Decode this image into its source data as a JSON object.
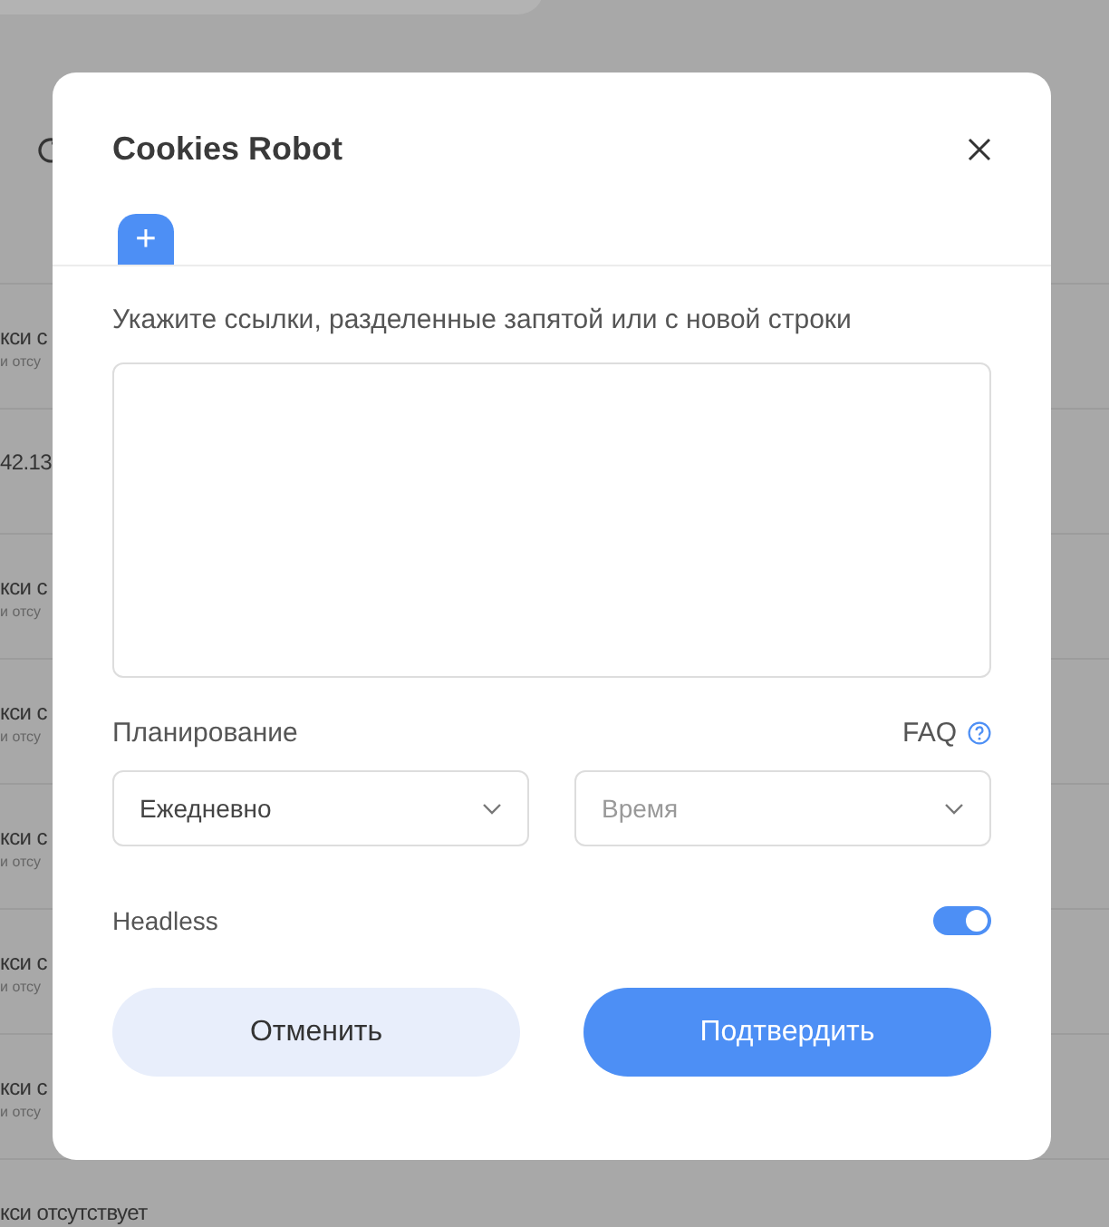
{
  "background": {
    "rows": [
      {
        "title": "кси с",
        "subtitle": "и отсу"
      },
      {
        "title": "42.13"
      },
      {
        "title": "кси с",
        "subtitle": "и отсу"
      },
      {
        "title": "кси с",
        "subtitle": "и отсу"
      },
      {
        "title": "кси с",
        "subtitle": "и отсу"
      },
      {
        "title": "кси с",
        "subtitle": "и отсу"
      },
      {
        "title": "кси с",
        "subtitle": "и отсу"
      },
      {
        "title": "кси отсутствует"
      }
    ]
  },
  "dialog": {
    "title": "Cookies Robot",
    "tabs": [
      {
        "label": "+",
        "selected": true
      }
    ],
    "links_label": "Укажите ссылки, разделенные запятой или с новой строки",
    "schedule_label": "Планирование",
    "faq": "FAQ",
    "frequency": {
      "value": "Ежедневно"
    },
    "time": {
      "placeholder": "Время"
    },
    "headless": {
      "label": "Headless",
      "on": true
    },
    "buttons": [
      {
        "label": "Отменить",
        "kind": "secondary"
      },
      {
        "label": "Подтвердить",
        "kind": "primary"
      }
    ]
  }
}
